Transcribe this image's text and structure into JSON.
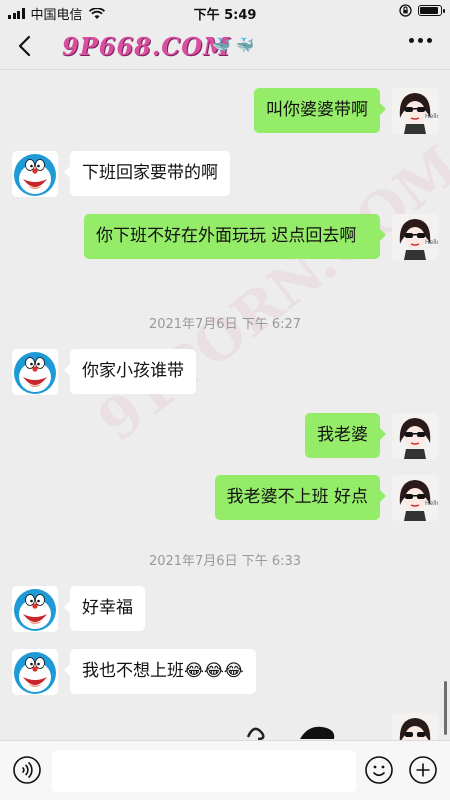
{
  "status_bar": {
    "carrier": "中国电信",
    "time": "下午 5:49",
    "battery_level": 0.9,
    "icons": [
      "signal-icon",
      "wifi-icon",
      "orientation-lock-icon",
      "battery-icon"
    ]
  },
  "header": {
    "title": "9P668.COM",
    "title_suffix": "🐳 🐳",
    "back_icon": "chevron-left-icon",
    "more_icon": "more-dots-icon"
  },
  "watermark": "91PORN.COM",
  "messages": [
    {
      "side": "out",
      "text": "叫你婆婆带啊"
    },
    {
      "side": "in",
      "text": "下班回家要带的啊"
    },
    {
      "side": "out",
      "text": "你下班不好在外面玩玩 迟点回去啊"
    },
    {
      "side": "time",
      "text": "2021年7月6日 下午 6:27"
    },
    {
      "side": "in",
      "text": "你家小孩谁带"
    },
    {
      "side": "out",
      "text": "我老婆"
    },
    {
      "side": "out",
      "text": "我老婆不上班 好点"
    },
    {
      "side": "time",
      "text": "2021年7月6日 下午 6:33"
    },
    {
      "side": "in",
      "text": "好幸福"
    },
    {
      "side": "in",
      "text": "我也不想上班😂😂😂"
    }
  ],
  "input_bar": {
    "voice_icon": "voice-icon",
    "emoji_icon": "emoji-icon",
    "plus_icon": "plus-icon",
    "placeholder": ""
  },
  "colors": {
    "background": "#ededed",
    "outgoing_bubble": "#95ec69",
    "incoming_bubble": "#ffffff",
    "title": "#d84fa0"
  }
}
